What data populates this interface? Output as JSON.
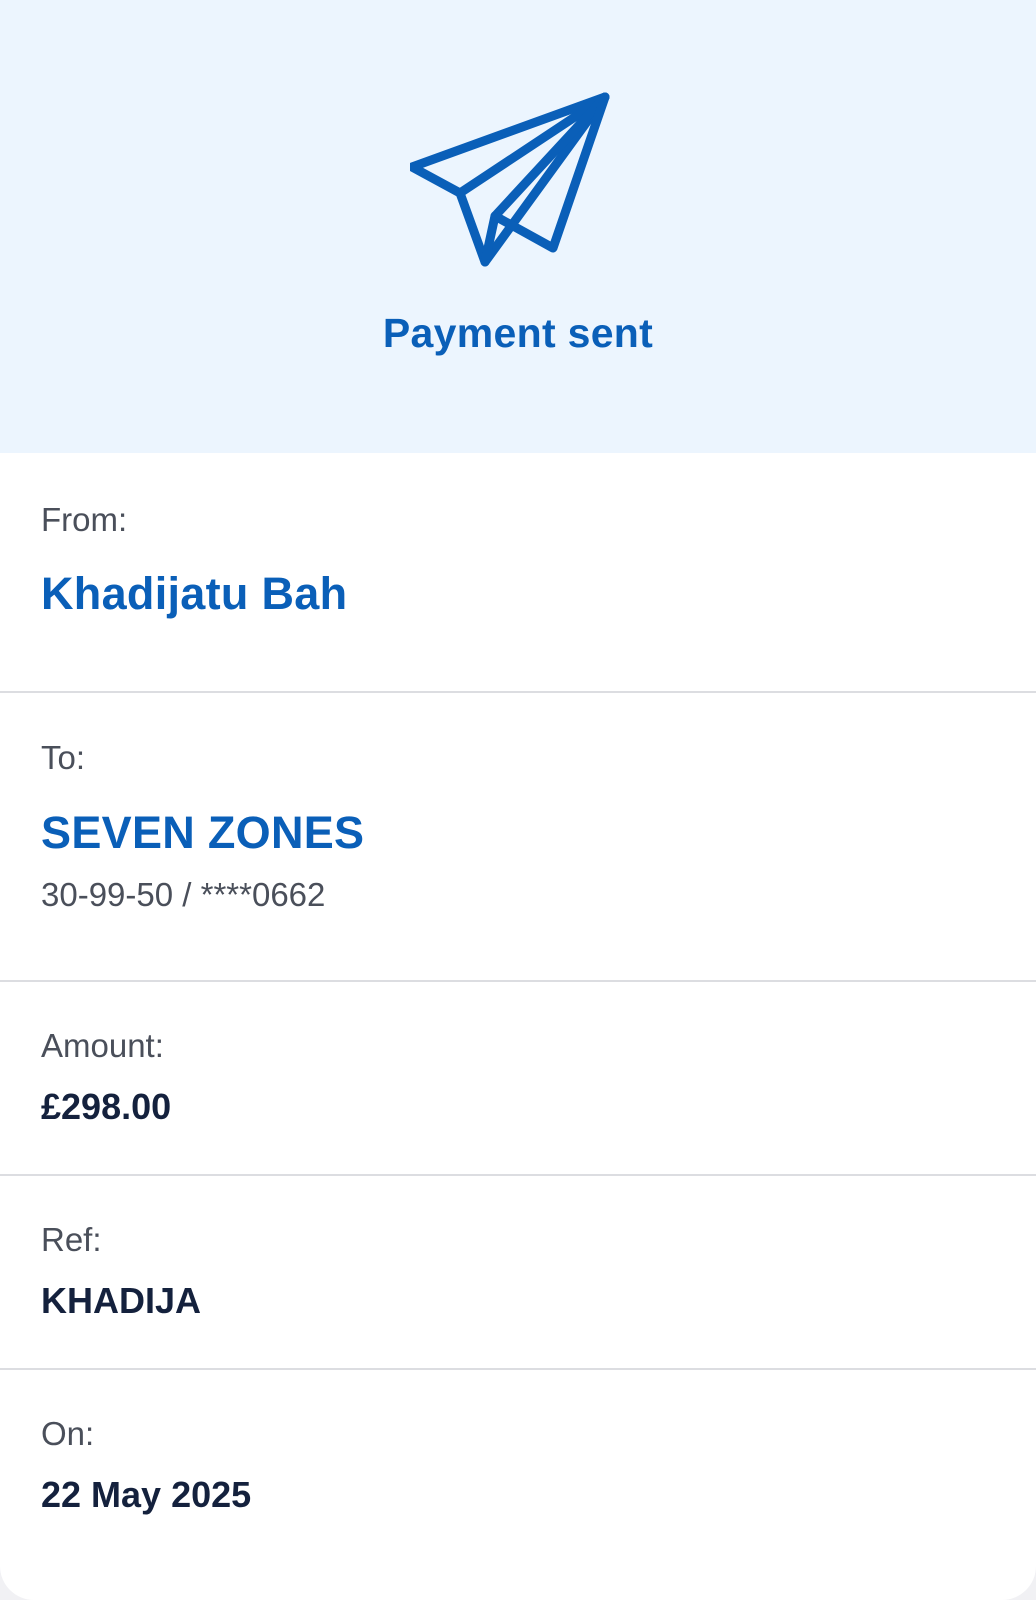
{
  "hero": {
    "icon": "paper-plane-icon",
    "title": "Payment sent"
  },
  "from": {
    "label": "From:",
    "name": "Khadijatu Bah"
  },
  "to": {
    "label": "To:",
    "name": "SEVEN ZONES",
    "account": "30-99-50 / ****0662"
  },
  "amount": {
    "label": "Amount:",
    "value": "£298.00"
  },
  "ref": {
    "label": "Ref:",
    "value": "KHADIJA"
  },
  "on": {
    "label": "On:",
    "value": "22 May 2025"
  },
  "colors": {
    "accent": "#0a5fb8",
    "hero_background": "#ecf5fe",
    "text_dark": "#14213d",
    "text_muted": "#4a4f5a",
    "divider": "#dcdde1"
  }
}
